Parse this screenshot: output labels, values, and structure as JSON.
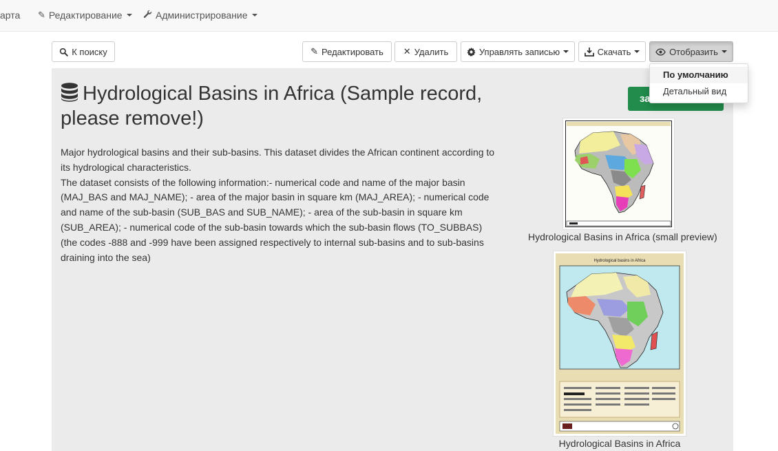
{
  "nav": {
    "map_label": "арта",
    "edit_label": "Редактирование",
    "admin_label": "Администрирование"
  },
  "toolbar": {
    "back_label": "К поиску",
    "edit_label": "Редактировать",
    "delete_label": "Удалить",
    "manage_label": "Управлять записью",
    "download_label": "Скачать",
    "display_label": "Отобразить"
  },
  "display_menu": {
    "items": [
      "По умолчанию",
      "Детальный вид"
    ],
    "selected": "По умолчанию"
  },
  "record": {
    "title": "Hydrological Basins in Africa (Sample record, please remove!)",
    "description": [
      "Major hydrological basins and their sub-basins. This dataset divides the African continent according to its hydrological characteristics.",
      "The dataset consists of the following information:- numerical code and name of the major basin (MAJ_BAS and MAJ_NAME); - area of the major basin in square km (MAJ_AREA); - numerical code and name of the sub-basin (SUB_BAS and SUB_NAME); - area of the sub-basin in square km (SUB_AREA); - numerical code of the sub-basin towards which the sub-basin flows (TO_SUBBAS) (the codes -888 and -999 have been assigned respectively to internal sub-basins and to sub-basins draining into the sea)"
    ],
    "green_button_label": "за",
    "previews": [
      {
        "caption": "Hydrological Basins in Africa (small preview)"
      },
      {
        "caption": "Hydrological Basins in Africa"
      }
    ],
    "map_header": "Hydrological basins in Africa"
  },
  "colors": {
    "accent_green": "#218c4c",
    "panel_bg": "#ebebeb",
    "navbar_bg": "#f8f8f8"
  }
}
